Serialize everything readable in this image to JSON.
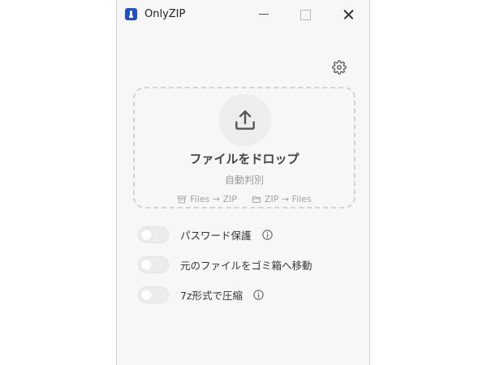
{
  "window": {
    "title": "OnlyZIP"
  },
  "dropzone": {
    "title": "ファイルをドロップ",
    "subtitle": "自動判別",
    "hints": [
      {
        "icon": "archive-icon",
        "label": "Files → ZIP"
      },
      {
        "icon": "folder-icon",
        "label": "ZIP → Files"
      }
    ]
  },
  "options": [
    {
      "label": "パスワード保護",
      "enabled": false,
      "has_info": true
    },
    {
      "label": "元のファイルをゴミ箱へ移動",
      "enabled": false,
      "has_info": false
    },
    {
      "label": "7z形式で圧縮",
      "enabled": false,
      "has_info": true
    }
  ],
  "colors": {
    "app_icon": "#1e4fd0",
    "window_bg": "#f7f7f7",
    "toggle_off": "#ececec",
    "dashed_border": "#d3d3d3"
  }
}
